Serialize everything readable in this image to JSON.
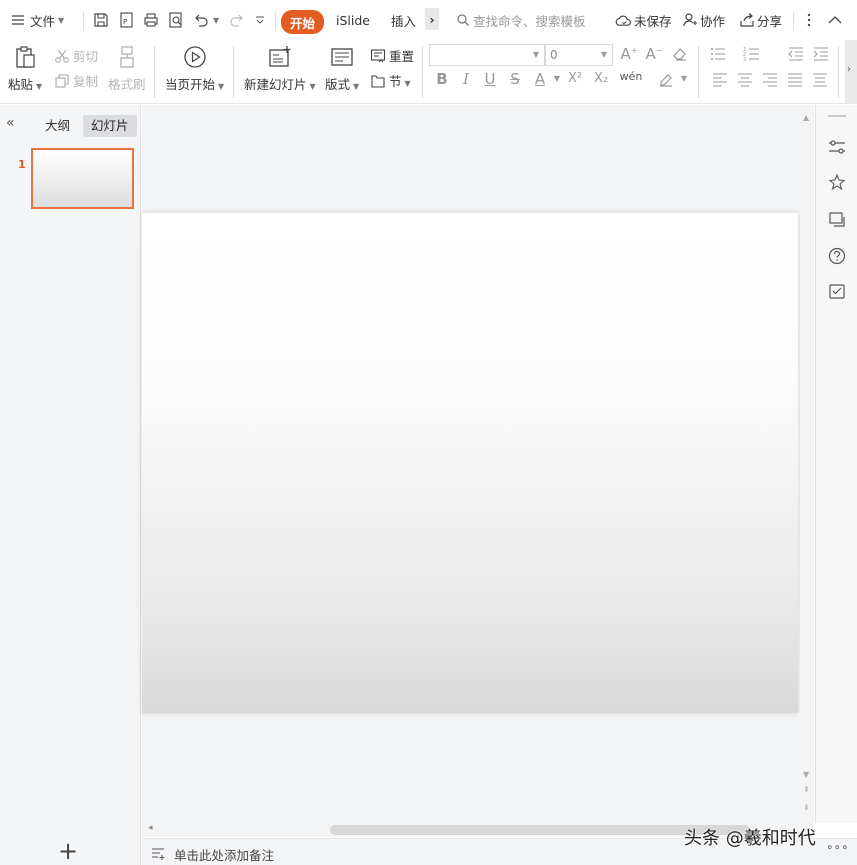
{
  "menubar": {
    "file_label": "文件",
    "tabs": [
      {
        "label": "开始",
        "active": true
      },
      {
        "label": "iSlide",
        "active": false
      },
      {
        "label": "插入",
        "active": false
      }
    ],
    "more_tabs": "›",
    "search_placeholder": "查找命令、搜索模板",
    "unsaved_label": "未保存",
    "collab_label": "协作",
    "share_label": "分享"
  },
  "ribbon": {
    "paste": "粘贴",
    "cut": "剪切",
    "copy": "复制",
    "format_painter": "格式刷",
    "play_from_current": "当页开始",
    "new_slide": "新建幻灯片",
    "layout": "版式",
    "reset": "重置",
    "section": "节",
    "font_name": "",
    "font_size": "0",
    "bold": "B",
    "italic": "I",
    "underline": "U",
    "strike": "S",
    "font_color": "A",
    "superscript": "X²",
    "subscript": "X₂",
    "phonetic": "wén"
  },
  "left_panel": {
    "outline_tab": "大纲",
    "slides_tab": "幻灯片",
    "collapse": "«",
    "slides": [
      {
        "number": "1"
      }
    ],
    "add_slide": "+"
  },
  "notes": {
    "placeholder": "单击此处添加备注"
  },
  "watermark": "头条 @羲和时代",
  "colors": {
    "accent": "#e35d22",
    "thumb_border": "#e8743b",
    "workspace_bg": "#f3f4f6"
  }
}
